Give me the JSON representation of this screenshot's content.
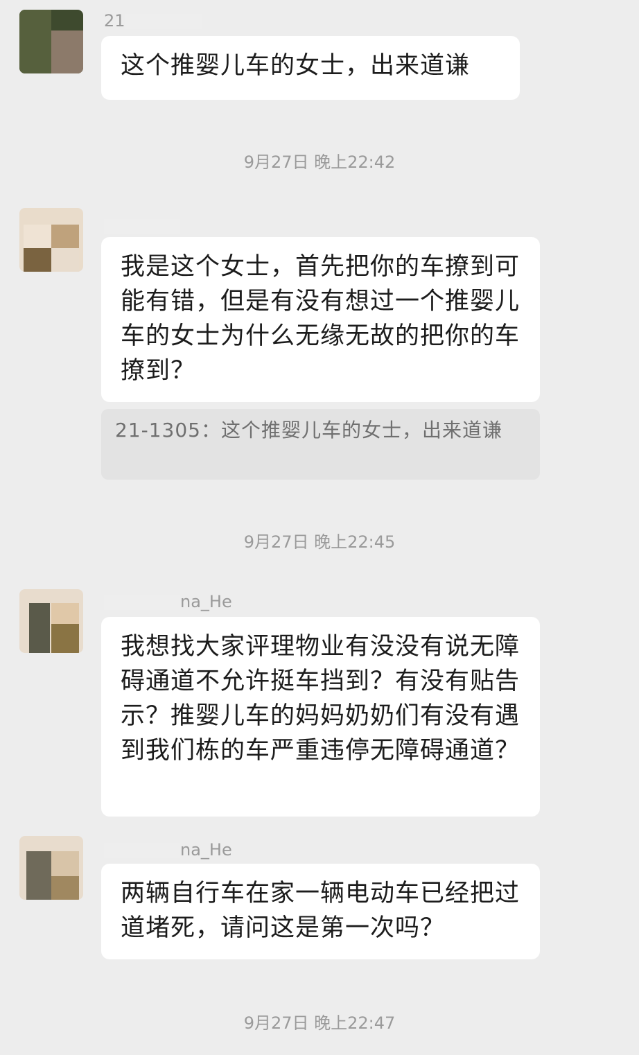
{
  "messages": [
    {
      "sender_partial": "21",
      "text": "这个推婴儿车的女士，出来道谦"
    },
    {
      "sender_partial": "",
      "text": "我是这个女士，首先把你的车撩到可能有错，但是有没有想过一个推婴儿车的女士为什么无缘无故的把你的车撩到？",
      "quote": "21-1305：这个推婴儿车的女士，出来道谦"
    },
    {
      "sender_partial": "na_He",
      "text": "我想找大家评理物业有没没有说无障碍通道不允许挺车挡到？有没有贴告示？推婴儿车的妈妈奶奶们有没有遇到我们栋的车严重违停无障碍通道？"
    },
    {
      "sender_partial": "na_He",
      "text": "两辆自行车在家一辆电动车已经把过道堵死，请问这是第一次吗？"
    }
  ],
  "timestamps": [
    "9月27日 晚上22:42",
    "9月27日 晚上22:45",
    "9月27日 晚上22:47"
  ],
  "colors": {
    "background": "#ededed",
    "bubble": "#ffffff",
    "quote": "#e3e3e3",
    "timestamp": "#9a9a9a"
  }
}
